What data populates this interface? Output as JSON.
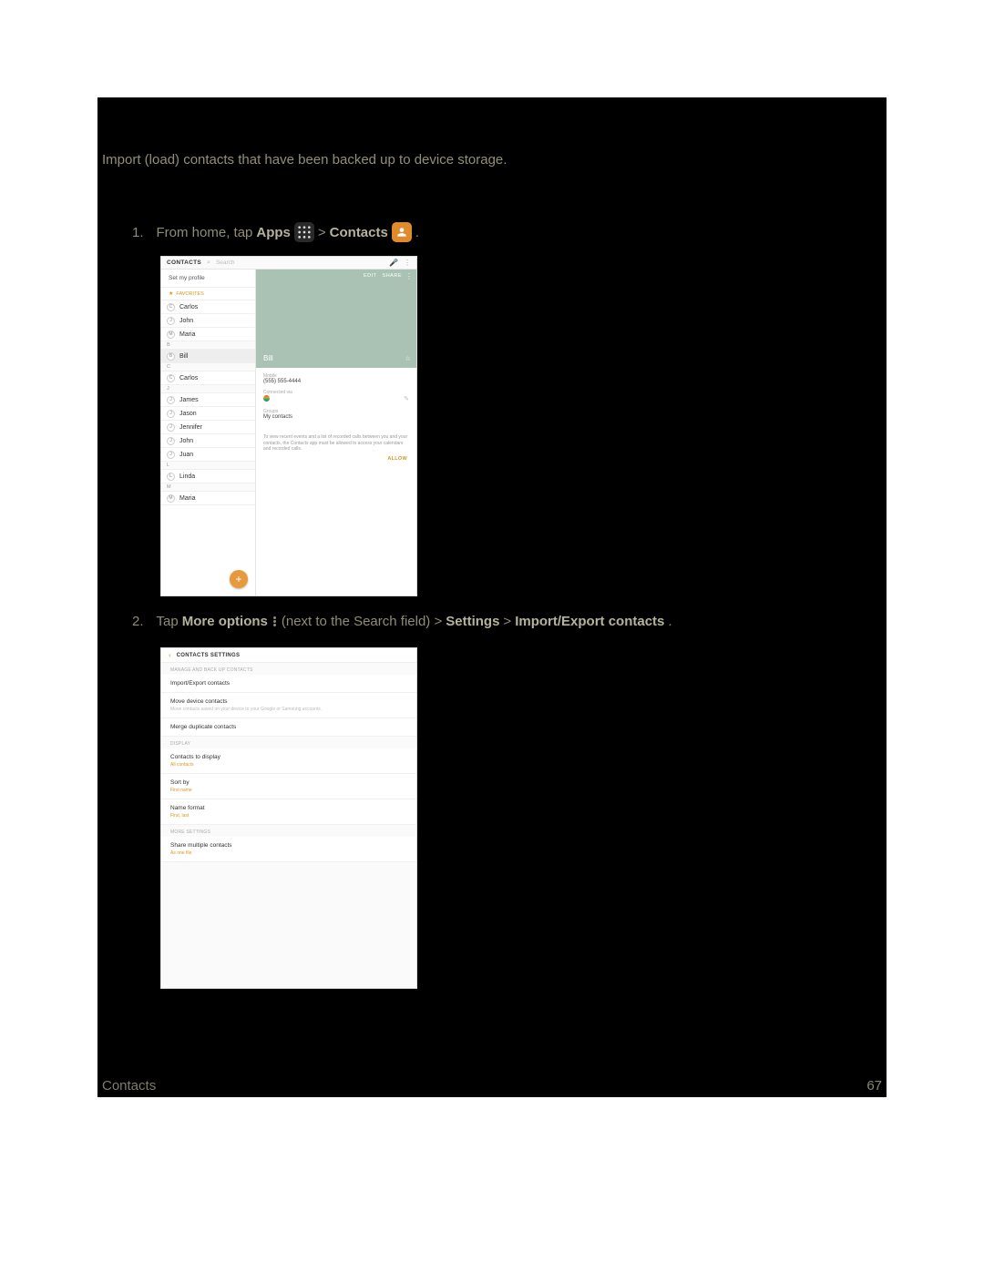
{
  "intro": "Import (load) contacts that have been backed up to device storage.",
  "step1": {
    "num": "1.",
    "pre": "From home, tap ",
    "apps": "Apps",
    "mid": " > ",
    "contacts": "Contacts",
    "tail": "."
  },
  "step2": {
    "num": "2.",
    "pre": "Tap ",
    "more": "More options",
    "mid1": " (next to the Search field) > ",
    "b2": "Settings",
    "mid2": " > ",
    "b3": "Import/Export contacts",
    "tail": "."
  },
  "shot1": {
    "title": "CONTACTS",
    "search_ph": "Search",
    "profile": "Set my profile",
    "fav_label": "FAVORITES",
    "favorites": [
      {
        "initial": "C",
        "name": "Carlos"
      },
      {
        "initial": "J",
        "name": "John"
      },
      {
        "initial": "M",
        "name": "Maria"
      }
    ],
    "sect_b": "B",
    "contacts_b": [
      {
        "initial": "B",
        "name": "Bill"
      }
    ],
    "sect_c": "C",
    "contacts_c": [
      {
        "initial": "C",
        "name": "Carlos"
      }
    ],
    "sect_j": "J",
    "contacts_j": [
      {
        "initial": "J",
        "name": "James"
      },
      {
        "initial": "J",
        "name": "Jason"
      },
      {
        "initial": "J",
        "name": "Jennifer"
      },
      {
        "initial": "J",
        "name": "John"
      },
      {
        "initial": "J",
        "name": "Juan"
      }
    ],
    "sect_l": "L",
    "contacts_l": [
      {
        "initial": "L",
        "name": "Linda"
      }
    ],
    "sect_m": "M",
    "contacts_m": [
      {
        "initial": "M",
        "name": "Maria"
      }
    ],
    "detail": {
      "edit": "EDIT",
      "share": "SHARE",
      "name": "Bill",
      "mobile_lbl": "Mobile",
      "mobile_val": "(555) 555-4444",
      "connected_lbl": "Connected via",
      "groups_lbl": "Groups",
      "groups_val": "My contacts",
      "perm_note": "To view recent events and a list of recorded calls between you and your contacts, the Contacts app must be allowed to access your calendars and recorded calls.",
      "allow": "ALLOW"
    }
  },
  "shot2": {
    "title": "CONTACTS SETTINGS",
    "grp1": "MANAGE AND BACK UP CONTACTS",
    "items1": [
      {
        "t": "Import/Export contacts",
        "s": ""
      },
      {
        "t": "Move device contacts",
        "s": "Move contacts saved on your device to your Google or Samsung accounts."
      },
      {
        "t": "Merge duplicate contacts",
        "s": ""
      }
    ],
    "grp2": "DISPLAY",
    "items2": [
      {
        "t": "Contacts to display",
        "s": "All contacts",
        "orange": true
      },
      {
        "t": "Sort by",
        "s": "First name",
        "orange": true
      },
      {
        "t": "Name format",
        "s": "First, last",
        "orange": true
      }
    ],
    "grp3": "MORE SETTINGS",
    "items3": [
      {
        "t": "Share multiple contacts",
        "s": "As one file",
        "orange": true
      }
    ]
  },
  "footer": {
    "section": "Contacts",
    "page": "67"
  }
}
